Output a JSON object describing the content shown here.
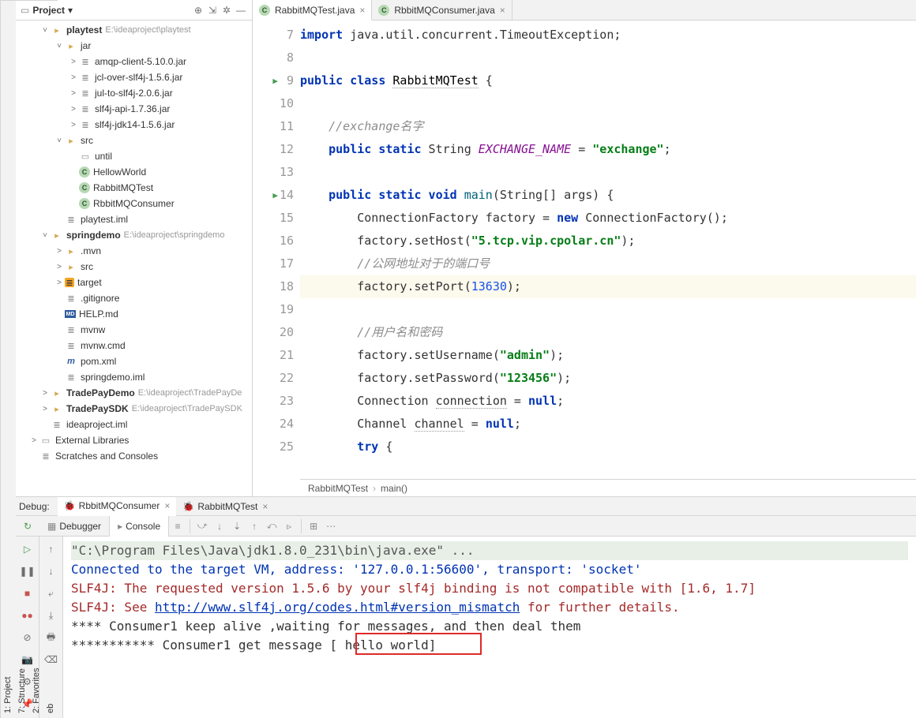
{
  "vtabs": [
    "1: Project",
    "7: Structure",
    "2: Favorites",
    "eb"
  ],
  "project": {
    "title": "Project",
    "items": [
      {
        "ind": 30,
        "tw": "˅",
        "icon": "folder",
        "bold": true,
        "label": "playtest",
        "path": "E:\\ideaproject\\playtest"
      },
      {
        "ind": 48,
        "tw": "˅",
        "icon": "folder",
        "label": "jar"
      },
      {
        "ind": 66,
        "tw": "˃",
        "icon": "file",
        "label": "amqp-client-5.10.0.jar"
      },
      {
        "ind": 66,
        "tw": "˃",
        "icon": "file",
        "label": "jcl-over-slf4j-1.5.6.jar"
      },
      {
        "ind": 66,
        "tw": "˃",
        "icon": "file",
        "label": "jul-to-slf4j-2.0.6.jar"
      },
      {
        "ind": 66,
        "tw": "˃",
        "icon": "file",
        "label": "slf4j-api-1.7.36.jar"
      },
      {
        "ind": 66,
        "tw": "˃",
        "icon": "file",
        "label": "slf4j-jdk14-1.5.6.jar"
      },
      {
        "ind": 48,
        "tw": "˅",
        "icon": "folder",
        "label": "src"
      },
      {
        "ind": 66,
        "tw": "",
        "icon": "pkg",
        "label": "until"
      },
      {
        "ind": 66,
        "tw": "",
        "icon": "cls",
        "iconText": "C",
        "label": "HellowWorld"
      },
      {
        "ind": 66,
        "tw": "",
        "icon": "cls",
        "iconText": "C",
        "label": "RabbitMQTest"
      },
      {
        "ind": 66,
        "tw": "",
        "icon": "cls",
        "iconText": "C",
        "label": "RbbitMQConsumer"
      },
      {
        "ind": 48,
        "tw": "",
        "icon": "file",
        "label": "playtest.iml"
      },
      {
        "ind": 30,
        "tw": "˅",
        "icon": "folder",
        "bold": true,
        "label": "springdemo",
        "path": "E:\\ideaproject\\springdemo"
      },
      {
        "ind": 48,
        "tw": "˃",
        "icon": "folder",
        "label": ".mvn"
      },
      {
        "ind": 48,
        "tw": "˃",
        "icon": "folder",
        "label": "src"
      },
      {
        "ind": 48,
        "tw": "˃",
        "icon": "tgt",
        "label": "target"
      },
      {
        "ind": 48,
        "tw": "",
        "icon": "file",
        "label": ".gitignore"
      },
      {
        "ind": 48,
        "tw": "",
        "icon": "md",
        "iconText": "MD",
        "label": "HELP.md"
      },
      {
        "ind": 48,
        "tw": "",
        "icon": "file",
        "label": "mvnw"
      },
      {
        "ind": 48,
        "tw": "",
        "icon": "file",
        "label": "mvnw.cmd"
      },
      {
        "ind": 48,
        "tw": "",
        "icon": "pom",
        "iconText": "m",
        "label": "pom.xml"
      },
      {
        "ind": 48,
        "tw": "",
        "icon": "file",
        "label": "springdemo.iml"
      },
      {
        "ind": 30,
        "tw": "˃",
        "icon": "folder",
        "bold": true,
        "label": "TradePayDemo",
        "path": "E:\\ideaproject\\TradePayDe"
      },
      {
        "ind": 30,
        "tw": "˃",
        "icon": "folder",
        "bold": true,
        "label": "TradePaySDK",
        "path": "E:\\ideaproject\\TradePaySDK"
      },
      {
        "ind": 30,
        "tw": "",
        "icon": "file",
        "label": "ideaproject.iml"
      },
      {
        "ind": 16,
        "tw": "˃",
        "icon": "pkg",
        "label": "External Libraries"
      },
      {
        "ind": 16,
        "tw": "",
        "icon": "file",
        "label": "Scratches and Consoles"
      }
    ]
  },
  "tabs": [
    {
      "label": "RabbitMQTest.java",
      "active": true
    },
    {
      "label": "RbbitMQConsumer.java",
      "active": false
    }
  ],
  "lines": [
    {
      "n": 7,
      "html": "<span class='k'>import</span> java.util.concurrent.TimeoutException;"
    },
    {
      "n": 8,
      "html": ""
    },
    {
      "n": 9,
      "run": true,
      "html": "<span class='k'>public class</span> <span class='cname dotted'>RabbitMQTest</span> {"
    },
    {
      "n": 10,
      "html": ""
    },
    {
      "n": 11,
      "html": "    <span class='c'>//exchange名字</span>"
    },
    {
      "n": 12,
      "html": "    <span class='k'>public static</span> String <span class='field'>EXCHANGE_NAME</span> = <span class='s'>\"exchange\"</span>;"
    },
    {
      "n": 13,
      "html": ""
    },
    {
      "n": 14,
      "run": true,
      "html": "    <span class='k'>public static void</span> <span class='fn'>main</span>(String[] args) {"
    },
    {
      "n": 15,
      "html": "        ConnectionFactory factory = <span class='k'>new</span> ConnectionFactory();"
    },
    {
      "n": 16,
      "html": "        factory.setHost(<span class='s'>\"5.tcp.vip.cpolar.cn\"</span>);"
    },
    {
      "n": 17,
      "html": "        <span class='c'>//公网地址对于的端口号</span>"
    },
    {
      "n": 18,
      "hl": true,
      "html": "        factory.setPort(<span class='n'>13630</span>);"
    },
    {
      "n": 19,
      "html": ""
    },
    {
      "n": 20,
      "html": "        <span class='c'>//用户名和密码</span>"
    },
    {
      "n": 21,
      "html": "        factory.setUsername(<span class='s'>\"admin\"</span>);"
    },
    {
      "n": 22,
      "html": "        factory.setPassword(<span class='s'>\"123456\"</span>);"
    },
    {
      "n": 23,
      "html": "        Connection <span class='dotted'>connection</span> = <span class='k'>null</span>;"
    },
    {
      "n": 24,
      "html": "        Channel <span class='dotted'>channel</span> = <span class='k'>null</span>;"
    },
    {
      "n": 25,
      "html": "        <span class='k'>try</span> {"
    }
  ],
  "breadcrumb": [
    "RabbitMQTest",
    "main()"
  ],
  "debug": {
    "label": "Debug:",
    "tabs": [
      {
        "label": "RbbitMQConsumer",
        "active": true
      },
      {
        "label": "RabbitMQTest",
        "active": false
      }
    ],
    "subtabs": {
      "debugger": "Debugger",
      "console": "Console"
    },
    "console": [
      {
        "cls": "cmd",
        "text": "\"C:\\Program Files\\Java\\jdk1.8.0_231\\bin\\java.exe\" ..."
      },
      {
        "cls": "blue",
        "text": "Connected to the target VM, address: '127.0.0.1:56600', transport: 'socket'"
      },
      {
        "cls": "red",
        "text": "SLF4J: The requested version 1.5.6 by your slf4j binding is not compatible with [1.6, 1.7]"
      },
      {
        "cls": "red",
        "html": "SLF4J: See <span class='link'>http://www.slf4j.org/codes.html#version_mismatch</span> for further details."
      },
      {
        "cls": "",
        "text": "  **** Consumer1 keep alive ,waiting for messages, and then deal them"
      },
      {
        "cls": "",
        "text": " *********** Consumer1 get message  [ hello world]"
      }
    ]
  }
}
